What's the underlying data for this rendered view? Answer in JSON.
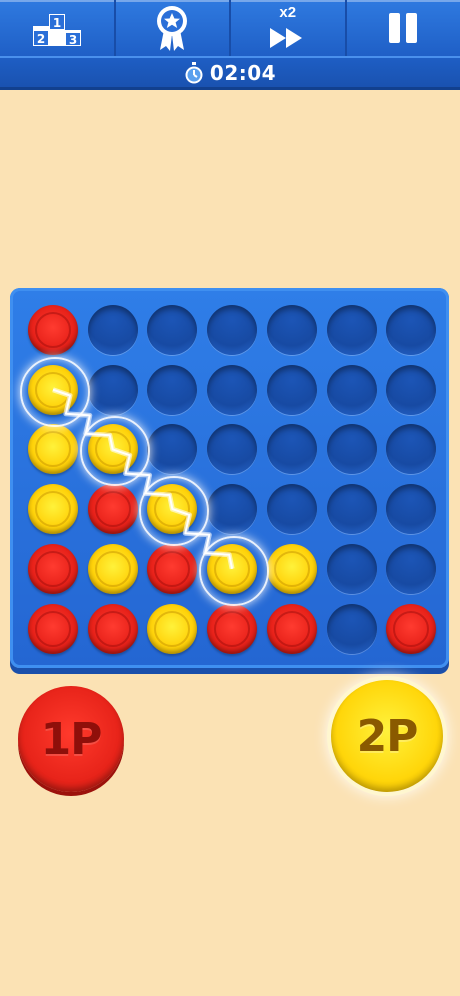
{
  "toolbar": {
    "items": [
      {
        "icon": "podium-icon",
        "podium_labels": [
          "1",
          "2",
          "3"
        ]
      },
      {
        "icon": "ribbon-star-icon"
      },
      {
        "icon": "fast-forward-icon",
        "speed_label": "x2"
      },
      {
        "icon": "pause-icon"
      }
    ]
  },
  "timer": {
    "icon": "stopwatch-icon",
    "value": "02:04"
  },
  "board": {
    "columns": 7,
    "rows": 6,
    "grid": [
      [
        "R",
        "E",
        "E",
        "E",
        "E",
        "E",
        "E"
      ],
      [
        "Y",
        "E",
        "E",
        "E",
        "E",
        "E",
        "E"
      ],
      [
        "Y",
        "Y",
        "E",
        "E",
        "E",
        "E",
        "E"
      ],
      [
        "Y",
        "R",
        "Y",
        "E",
        "E",
        "E",
        "E"
      ],
      [
        "R",
        "Y",
        "R",
        "Y",
        "Y",
        "E",
        "E"
      ],
      [
        "R",
        "R",
        "Y",
        "R",
        "R",
        "E",
        "R"
      ]
    ],
    "winning_cells": [
      [
        1,
        0
      ],
      [
        2,
        1
      ],
      [
        3,
        2
      ],
      [
        4,
        3
      ]
    ],
    "colors": {
      "red": "#e8221a",
      "yellow": "#ffd20a",
      "board": "#2466d2",
      "background": "#fbe2b4"
    }
  },
  "players": {
    "p1": {
      "label": "1P",
      "color": "red"
    },
    "p2": {
      "label": "2P",
      "color": "yellow",
      "active": true
    }
  }
}
